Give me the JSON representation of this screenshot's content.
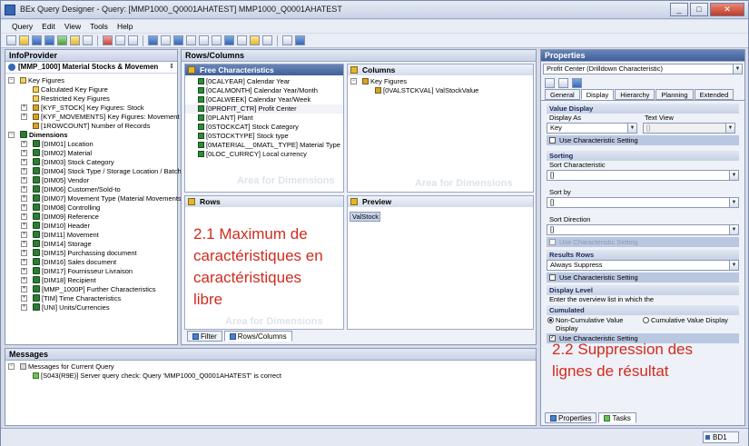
{
  "window": {
    "title": "BEx Query Designer - Query: [MMP1000_Q0001AHATEST] MMP1000_Q0001AHATEST"
  },
  "menu": [
    "Query",
    "Edit",
    "View",
    "Tools",
    "Help"
  ],
  "infoprovider": {
    "header": "InfoProvider",
    "selector": "[MMP_1000] Material Stocks & Movemen",
    "key_figures": {
      "label": "Key Figures",
      "items": [
        "Calculated Key Figure",
        "Restricted Key Figures",
        "[KYF_STOCK] Key Figures: Stock",
        "[KYF_MOVEMENTS] Key Figures: Movement",
        "[1ROWCOUNT] Number of Records"
      ]
    },
    "dimensions": {
      "label": "Dimensions",
      "items": [
        "[DIM01] Location",
        "[DIM02] Material",
        "[DIM03] Stock Category",
        "[DIM04] Stock Type / Storage Location / Batch",
        "[DIM05] Vendor",
        "[DIM06] Customer/Sold-to",
        "[DIM07] Movement Type (Material Movements",
        "[DIM08] Controlling",
        "[DIM09] Reference",
        "[DIM10] Header",
        "[DIM11] Movement",
        "[DIM14] Storage",
        "[DIM15] Purchassing document",
        "[DIM16] Sales document",
        "[DIM17] Fournisseur Livraison",
        "[DIM18] Recipient",
        "[MMP_1000P] Further Characteristics",
        "[TIM] Time Characteristics",
        "[UNI] Units/Currencies"
      ]
    }
  },
  "rowscols": {
    "header": "Rows/Columns",
    "free_header": "Free Characteristics",
    "free_items": [
      "[0CALYEAR] Calendar Year",
      "[0CALMONTH] Calendar Year/Month",
      "[0CALWEEK] Calendar Year/Week",
      "[0PROFIT_CTR] Profit Center",
      "[0PLANT] Plant",
      "[0STOCKCAT] Stock Category",
      "[0STOCKTYPE] Stock type",
      "[0MATERIAL__0MATL_TYPE] Material Type",
      "[0LOC_CURRCY] Local currency"
    ],
    "columns_header": "Columns",
    "columns_key_figures": "Key Figures",
    "columns_item": "[0VALSTCKVAL] ValStockValue",
    "rows_header": "Rows",
    "preview_header": "Preview",
    "preview_cell": "ValStock",
    "area_hint": "Area for Dimensions",
    "tabs": [
      "Filter",
      "Rows/Columns"
    ]
  },
  "annotations": {
    "left": [
      "2.1 Maximum de",
      "caractéristiques en",
      "caractéristiques",
      "libre"
    ],
    "right": [
      "2.2 Suppression des",
      "lignes de résultat"
    ]
  },
  "messages": {
    "header": "Messages",
    "group": "Messages for Current Query",
    "item": "[S043(R9E)] Server query check: Query 'MMP1000_Q0001AHATEST' is correct"
  },
  "properties": {
    "header": "Properties",
    "selector": "Profit Center (Drilldown Characteristic)",
    "tabs": [
      "General",
      "Display",
      "Hierarchy",
      "Planning",
      "Extended"
    ],
    "value_display": {
      "title": "Value Display",
      "display_as_label": "Display As",
      "display_as_value": "Key",
      "text_view_label": "Text View",
      "text_view_value": "[]",
      "use_setting": "Use Characteristic Setting"
    },
    "sorting": {
      "title": "Sorting",
      "sort_char_label": "Sort Characteristic",
      "sort_char_value": "[]",
      "sort_by_label": "Sort by",
      "sort_by_value": "[]",
      "sort_dir_label": "Sort Direction",
      "sort_dir_value": "[]",
      "use_setting": "Use Characteristic Setting"
    },
    "result_rows": {
      "title": "Results Rows",
      "value": "Always Suppress",
      "use_setting": "Use Characteristic Setting"
    },
    "display_level": {
      "title": "Display Level",
      "text": "Enter the overview list in which the"
    },
    "cumulated": {
      "title": "Cumulated",
      "opt1": "Non-Cumulative Value",
      "opt1b": "Display",
      "opt2": "Cumulative Value Display",
      "use_setting": "Use Characteristic Setting"
    },
    "bottom_tabs": [
      "Properties",
      "Tasks"
    ]
  },
  "status": {
    "system": "BD1"
  }
}
